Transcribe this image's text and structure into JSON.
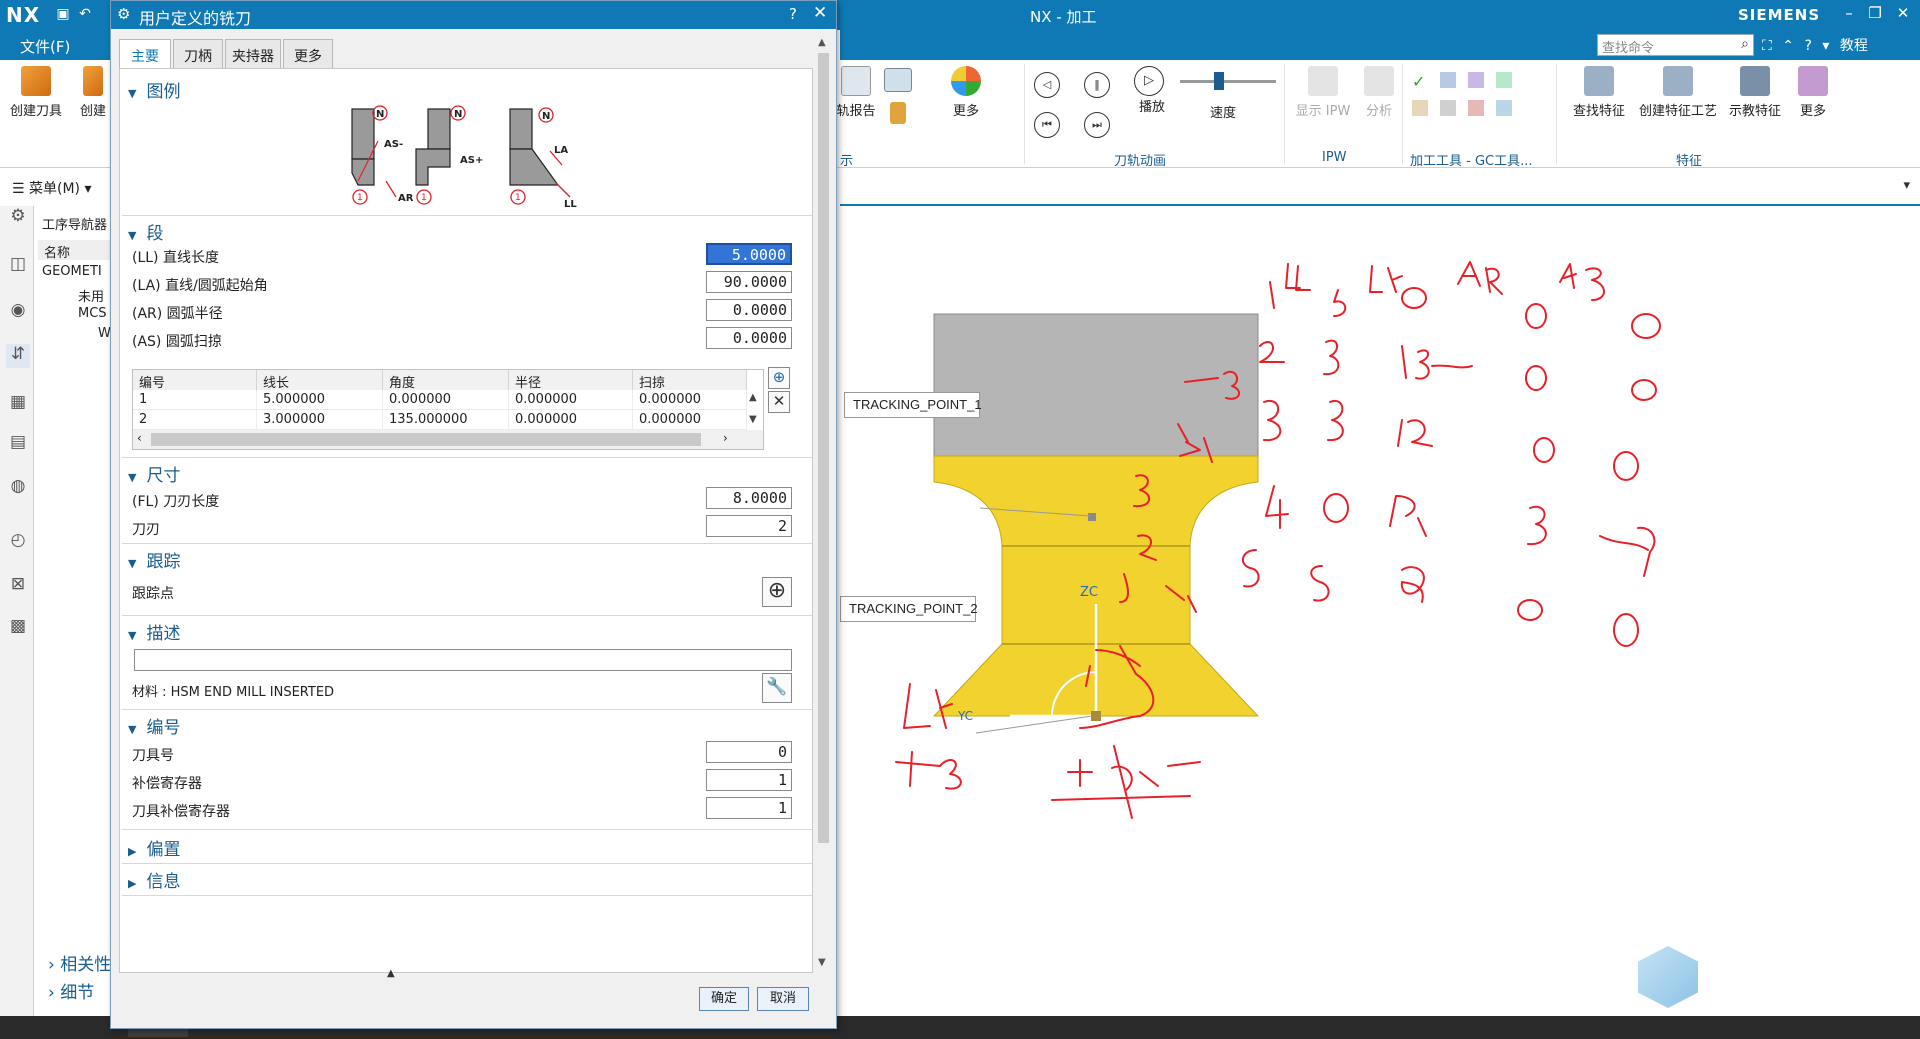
{
  "app": {
    "logo": "NX",
    "title": "NX - 加工",
    "brand": "SIEMENS",
    "file_menu": "文件(F)",
    "search_placeholder": "查找命令",
    "help_label": "教程"
  },
  "ribbon": {
    "left_buttons": [
      "创建刀具",
      "创建"
    ],
    "mid_buttons": [
      "轨报告",
      "更多"
    ],
    "anim_buttons": [
      "播放",
      "速度"
    ],
    "anim_group": "刀轨动画",
    "ipw_buttons": [
      "显示 IPW",
      "分析"
    ],
    "ipw_group": "IPW",
    "gc_group": "加工工具 - GC工具...",
    "feature_buttons": [
      "查找特征",
      "创建特征工艺",
      "示教特征",
      "更多"
    ],
    "feature_group": "特征",
    "left_group_stub": "示"
  },
  "menu": {
    "label": "菜单(M)"
  },
  "navigator": {
    "title": "工序导航器",
    "column": "名称",
    "rows": [
      "GEOMETI",
      "未用",
      "MCS",
      "W"
    ],
    "sections": [
      "相关性",
      "细节"
    ]
  },
  "dialog": {
    "title": "用户定义的铣刀",
    "tabs": [
      "主要",
      "刀柄",
      "夹持器",
      "更多"
    ],
    "sections": {
      "legend": "图例",
      "segment": "段",
      "dimensions": "尺寸",
      "tracking": "跟踪",
      "description": "描述",
      "numbering": "编号",
      "offset": "偏置",
      "info": "信息"
    },
    "legend_labels": [
      "N",
      "AS-",
      "AR",
      "N",
      "AS+",
      "N",
      "LA",
      "LL"
    ],
    "segment_fields": [
      {
        "label": "(LL) 直线长度",
        "value": "5.0000"
      },
      {
        "label": "(LA) 直线/圆弧起始角",
        "value": "90.0000"
      },
      {
        "label": "(AR) 圆弧半径",
        "value": "0.0000"
      },
      {
        "label": "(AS) 圆弧扫掠",
        "value": "0.0000"
      }
    ],
    "table": {
      "headers": [
        "编号",
        "线长",
        "角度",
        "半径",
        "扫掠"
      ],
      "rows": [
        [
          "1",
          "5.000000",
          "0.000000",
          "0.000000",
          "0.000000"
        ],
        [
          "2",
          "3.000000",
          "135.000000",
          "0.000000",
          "0.000000"
        ]
      ]
    },
    "flute_length": {
      "label": "(FL) 刀刃长度",
      "value": "8.0000"
    },
    "flutes": {
      "label": "刀刃",
      "value": "2"
    },
    "tracking_point": {
      "label": "跟踪点"
    },
    "description_text": "",
    "material": "材料 : HSM END MILL INSERTED",
    "numbering_fields": [
      {
        "label": "刀具号",
        "value": "0"
      },
      {
        "label": "补偿寄存器",
        "value": "1"
      },
      {
        "label": "刀具补偿寄存器",
        "value": "1"
      }
    ],
    "ok": "确定",
    "cancel": "取消"
  },
  "viewport": {
    "tracking_point_1": "TRACKING_POINT_1",
    "tracking_point_2": "TRACKING_POINT_2",
    "axis_zc": "ZC",
    "axis_yc": "YC",
    "colors": {
      "holder": "#b5b5b5",
      "tool": "#f2d22e",
      "annotation": "#e8202a"
    }
  }
}
